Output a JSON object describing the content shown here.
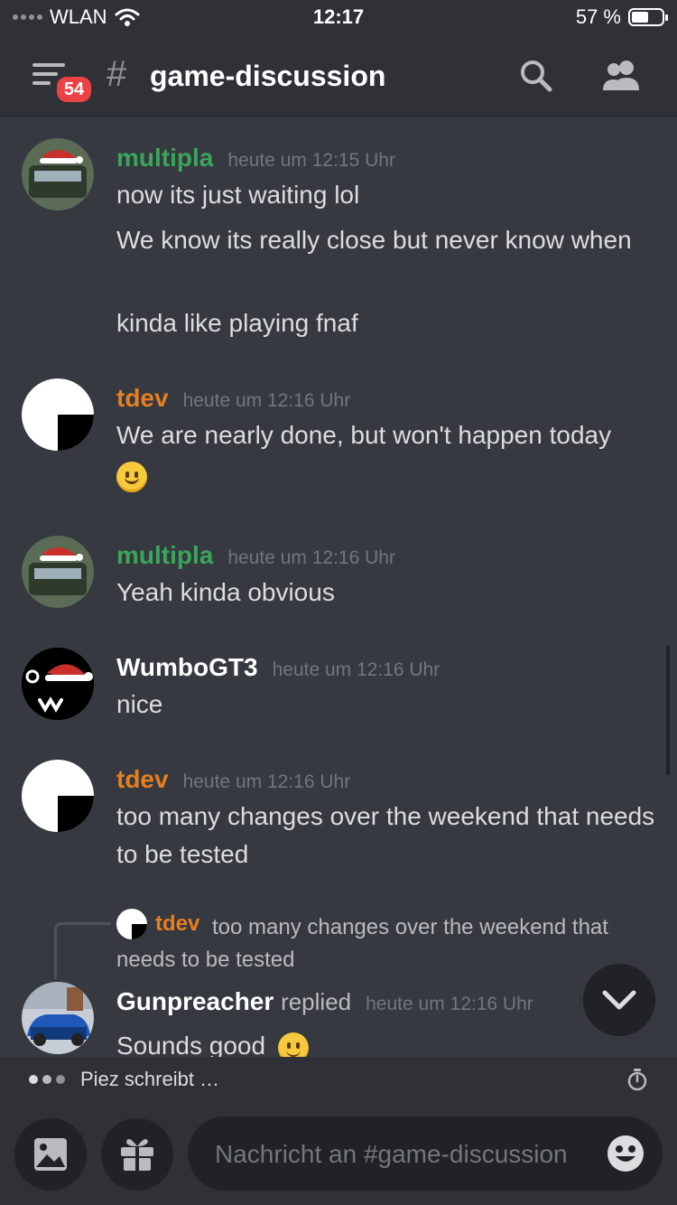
{
  "status_bar": {
    "carrier": "WLAN",
    "time": "12:17",
    "battery": "57 %"
  },
  "header": {
    "unread_count": "54",
    "channel_hash": "#",
    "channel_name": "game-discussion"
  },
  "messages": [
    {
      "author": "multipla",
      "author_color": "#3ba55c",
      "timestamp": "heute um 12:15 Uhr",
      "lines": [
        "now its just waiting lol",
        "We know its really close but never know when",
        "kinda like playing fnaf"
      ]
    },
    {
      "author": "tdev",
      "author_color": "#e67e22",
      "timestamp": "heute um 12:16 Uhr",
      "lines": [
        "We are nearly done, but won't happen today"
      ],
      "emoji": "slightly-smiling-face"
    },
    {
      "author": "multipla",
      "author_color": "#3ba55c",
      "timestamp": "heute um 12:16 Uhr",
      "lines": [
        "Yeah kinda obvious"
      ]
    },
    {
      "author": "WumboGT3",
      "author_color": "#ffffff",
      "timestamp": "heute um 12:16 Uhr",
      "lines": [
        "nice"
      ]
    },
    {
      "author": "tdev",
      "author_color": "#e67e22",
      "timestamp": "heute um 12:16 Uhr",
      "lines": [
        "too many changes over the weekend that needs to be tested"
      ]
    },
    {
      "author": "Gunpreacher",
      "author_color": "#ffffff",
      "replied_label": "replied",
      "timestamp": "heute um 12:16 Uhr",
      "reply_to": {
        "author": "tdev",
        "text": "too many changes over the weekend that needs to be tested"
      },
      "lines": [
        "Sounds good"
      ],
      "emoji": "relieved-face"
    }
  ],
  "typing": {
    "text": "Piez schreibt …"
  },
  "composer": {
    "placeholder": "Nachricht an #game-discussion"
  },
  "icons": [
    "menu-icon",
    "search-icon",
    "members-icon",
    "chevron-down-icon",
    "timer-icon",
    "image-icon",
    "gift-icon",
    "emoji-icon"
  ]
}
